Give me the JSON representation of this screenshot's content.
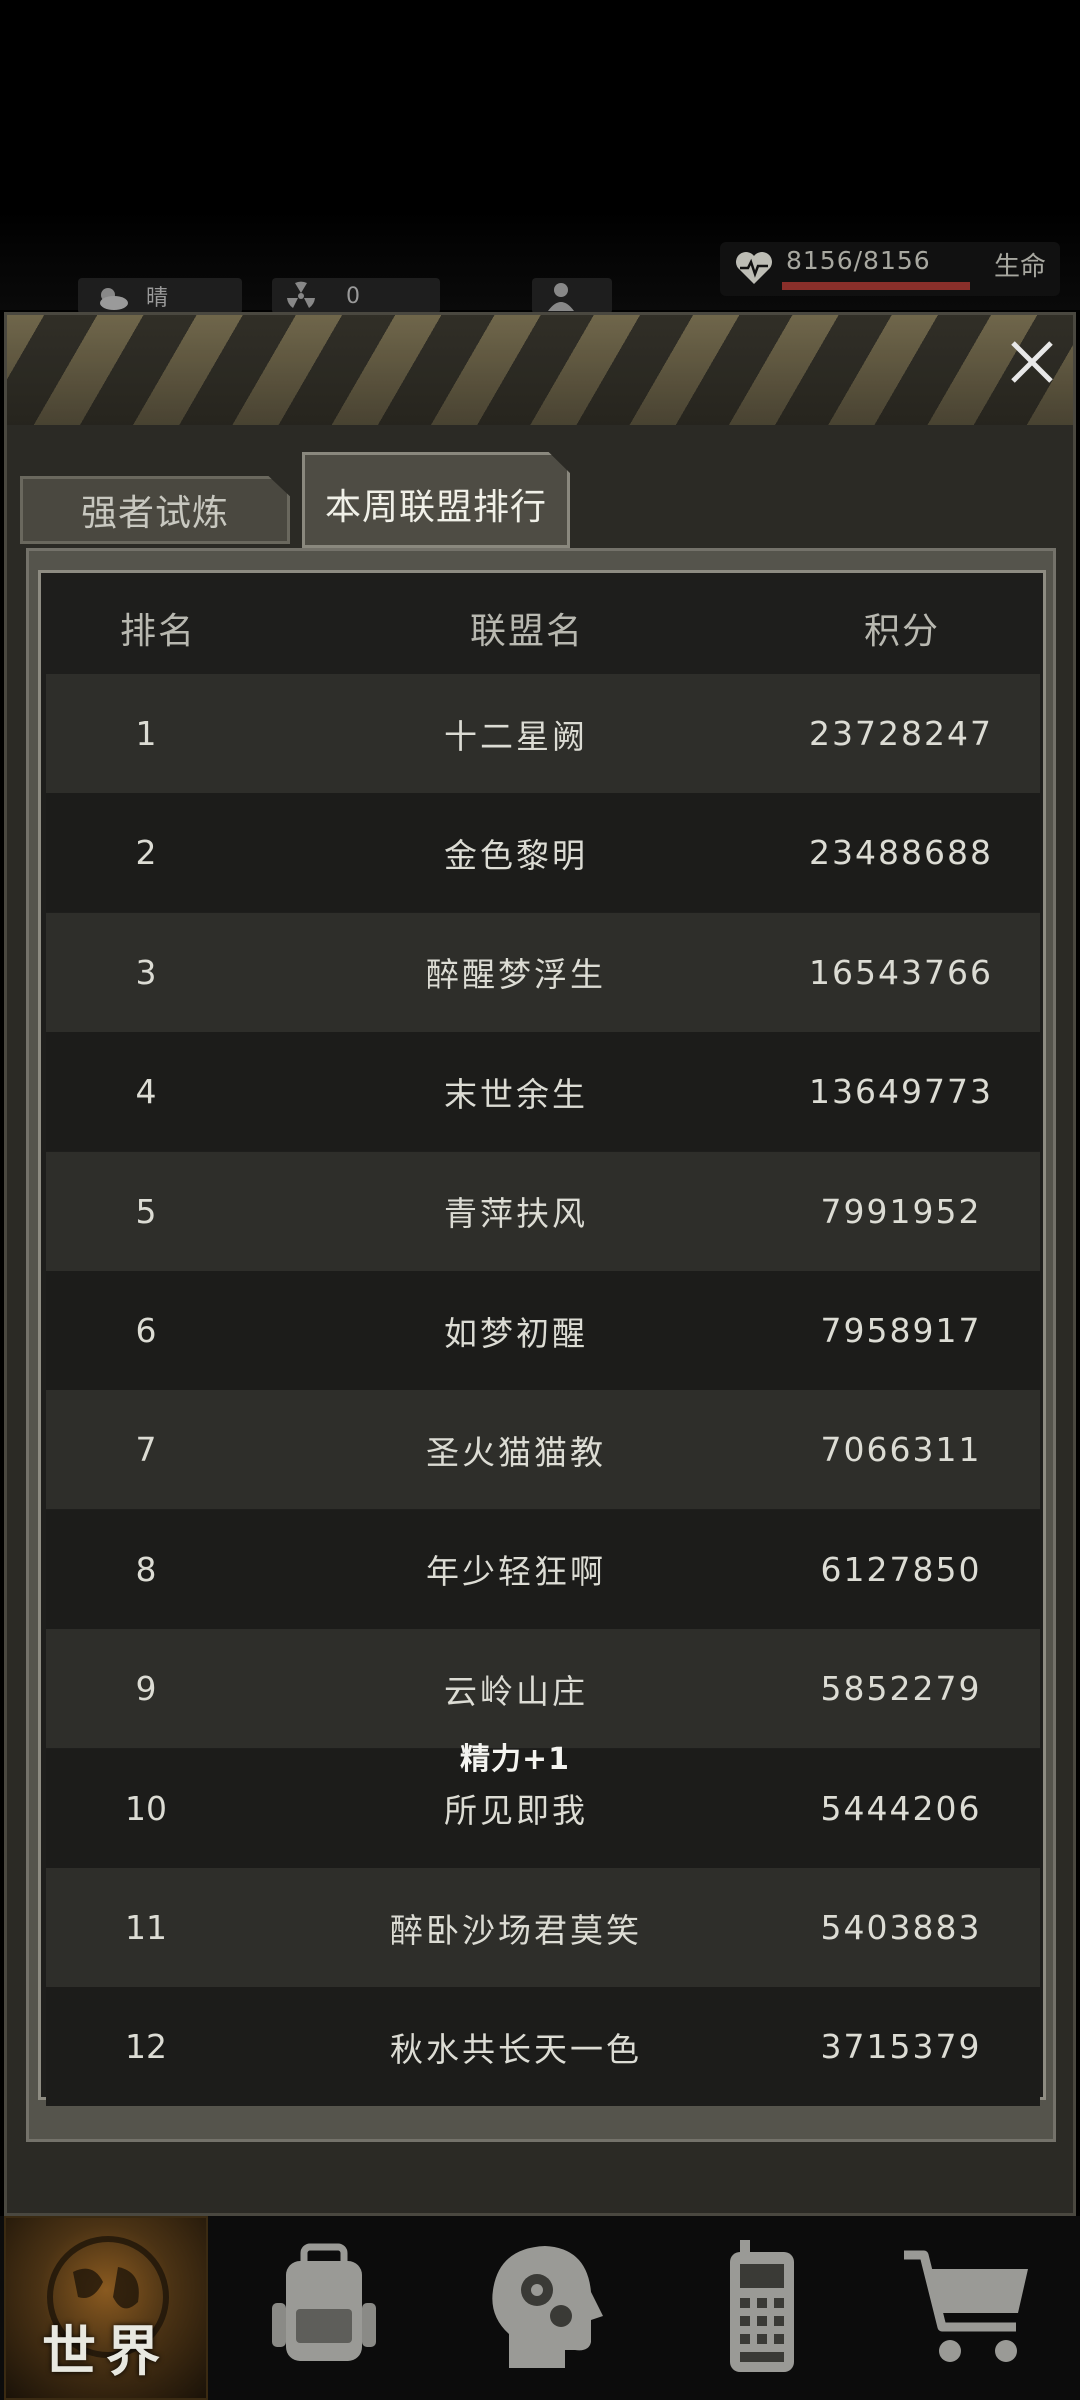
{
  "status": {
    "weather": "晴",
    "radiation": "0",
    "hp": "8156/8156",
    "hp_label": "生命",
    "hp_fraction": 1.0
  },
  "tabs": [
    {
      "label": "强者试炼",
      "active": false
    },
    {
      "label": "本周联盟排行",
      "active": true
    }
  ],
  "table": {
    "headers": {
      "rank": "排名",
      "name": "联盟名",
      "score": "积分"
    },
    "rows": [
      {
        "rank": "1",
        "name": "十二星阙",
        "score": "23728247"
      },
      {
        "rank": "2",
        "name": "金色黎明",
        "score": "23488688"
      },
      {
        "rank": "3",
        "name": "醉醒梦浮生",
        "score": "16543766"
      },
      {
        "rank": "4",
        "name": "末世余生",
        "score": "13649773"
      },
      {
        "rank": "5",
        "name": "青萍扶风",
        "score": "7991952"
      },
      {
        "rank": "6",
        "name": "如梦初醒",
        "score": "7958917"
      },
      {
        "rank": "7",
        "name": "圣火猫猫教",
        "score": "7066311"
      },
      {
        "rank": "8",
        "name": "年少轻狂啊",
        "score": "6127850"
      },
      {
        "rank": "9",
        "name": "云岭山庄",
        "score": "5852279"
      },
      {
        "rank": "10",
        "name": "所见即我",
        "score": "5444206"
      },
      {
        "rank": "11",
        "name": "醉卧沙场君莫笑",
        "score": "5403883"
      },
      {
        "rank": "12",
        "name": "秋水共长天一色",
        "score": "3715379"
      }
    ]
  },
  "toast": "精力+1",
  "nav": {
    "world_label": "世界",
    "items": [
      "globe-icon",
      "backpack-icon",
      "head-gears-icon",
      "radio-icon",
      "cart-icon"
    ]
  },
  "colors": {
    "panel_bg": "#2b2a25",
    "row_odd": "#2e2e2a",
    "row_even": "#1c1c1a",
    "hp_bar": "#8a2f2a",
    "hazard_stripe": "#b9a878"
  }
}
